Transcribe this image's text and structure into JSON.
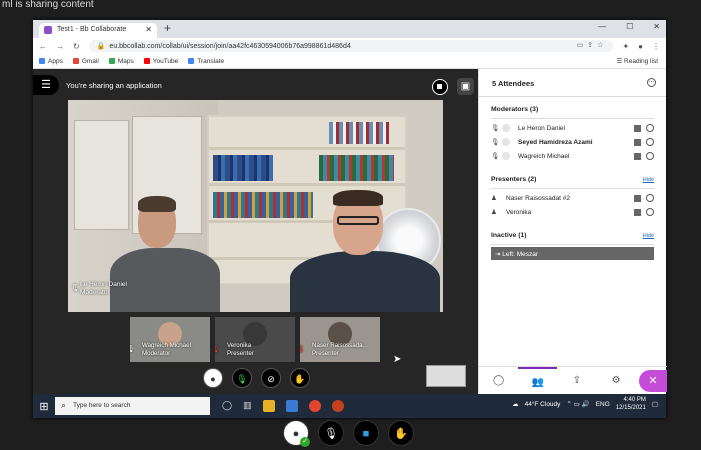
{
  "outer": {
    "banner": "ml is sharing content"
  },
  "browser": {
    "tab_title": "Test1 - Bb Collaborate",
    "new_tab": "+",
    "win_controls": [
      "—",
      "☐",
      "✕"
    ],
    "url": "eu.bbcollab.com/collab/ui/session/join/aa42fc4630594006b76a998861d486d4",
    "bookmarks": [
      {
        "label": "Apps",
        "color": "#4285f4"
      },
      {
        "label": "Gmail",
        "color": "#ea4335"
      },
      {
        "label": "Maps",
        "color": "#34a853"
      },
      {
        "label": "YouTube",
        "color": "#ff0000"
      },
      {
        "label": "Translate",
        "color": "#4285f4"
      }
    ],
    "reading_list": "Reading list"
  },
  "session": {
    "share_text": "You're sharing an application",
    "main_name": "Le Heron Daniel",
    "main_role": "Moderator",
    "thumbs": [
      {
        "name": "Wagreich Michael",
        "role": "Moderator",
        "muted": false
      },
      {
        "name": "Veronika",
        "role": "Presenter",
        "muted": true
      },
      {
        "name": "Naser Raisossada...",
        "role": "Presenter",
        "muted": true
      }
    ]
  },
  "panel": {
    "title": "5 Attendees",
    "moderators_title": "Moderators (3)",
    "moderators": [
      {
        "name": "Le Heron Daniel",
        "bold": false
      },
      {
        "name": "Seyed Hamidreza Azami",
        "bold": true
      },
      {
        "name": "Wagreich Michael",
        "bold": false
      }
    ],
    "presenters_title": "Presenters (2)",
    "presenters_hide": "Hide",
    "presenters": [
      {
        "name": "Naser Raisossadat #2"
      },
      {
        "name": "Veronika"
      }
    ],
    "inactive_title": "Inactive (1)",
    "inactive_hide": "Hide",
    "inactive_row": "Left: Meszar"
  },
  "taskbar": {
    "search_placeholder": "Type here to search",
    "weather": "44°F  Cloudy",
    "lang": "ENG",
    "time": "4:40 PM",
    "date": "12/15/2021"
  }
}
